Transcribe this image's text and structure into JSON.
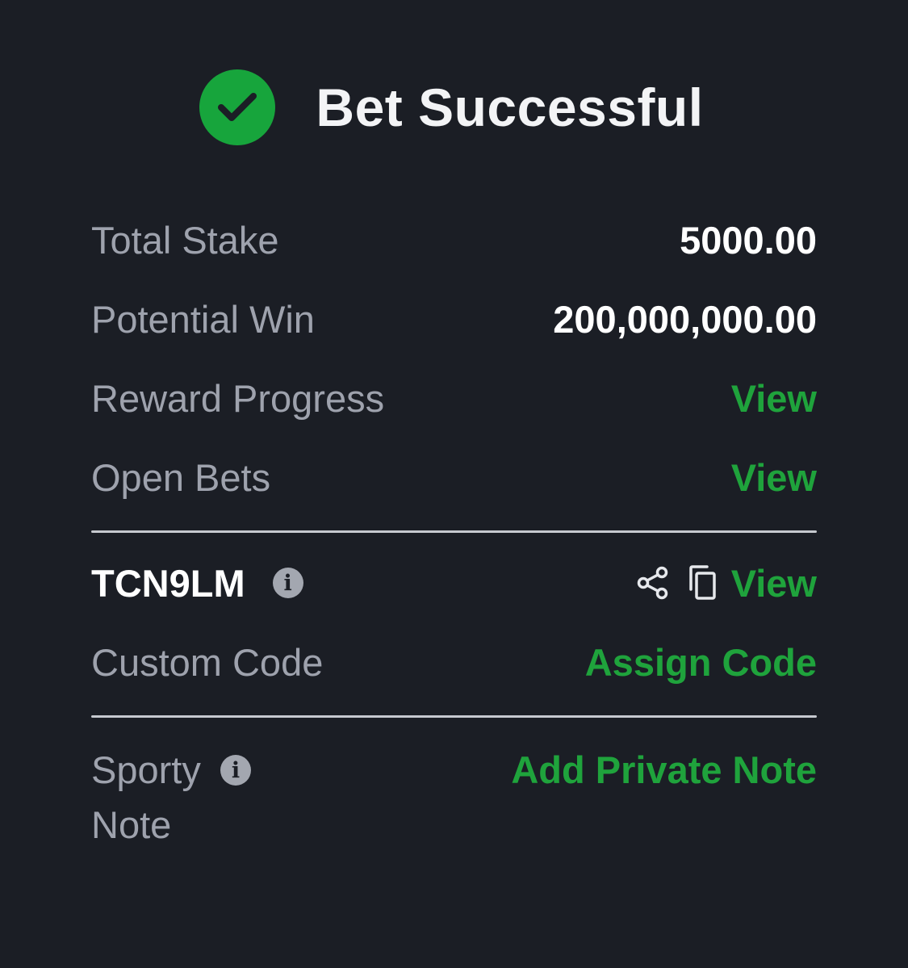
{
  "header": {
    "icon": "check-circle-icon",
    "title": "Bet Successful"
  },
  "summary": {
    "total_stake_label": "Total Stake",
    "total_stake_value": "5000.00",
    "potential_win_label": "Potential Win",
    "potential_win_value": "200,000,000.00",
    "reward_progress_label": "Reward Progress",
    "reward_progress_link": "View",
    "open_bets_label": "Open Bets",
    "open_bets_link": "View"
  },
  "booking": {
    "code": "TCN9LM",
    "info_icon": "info-icon",
    "share_icon": "share-icon",
    "copy_icon": "copy-icon",
    "view_link": "View",
    "custom_code_label": "Custom Code",
    "assign_code_link": "Assign Code"
  },
  "note": {
    "label": "Sporty Note",
    "info_icon": "info-icon",
    "add_note_link": "Add Private Note"
  },
  "colors": {
    "background": "#1b1e25",
    "accent_green": "#1fa33c",
    "check_green": "#17a53c",
    "label_gray": "#9ea2ad",
    "value_white": "#ffffff"
  }
}
